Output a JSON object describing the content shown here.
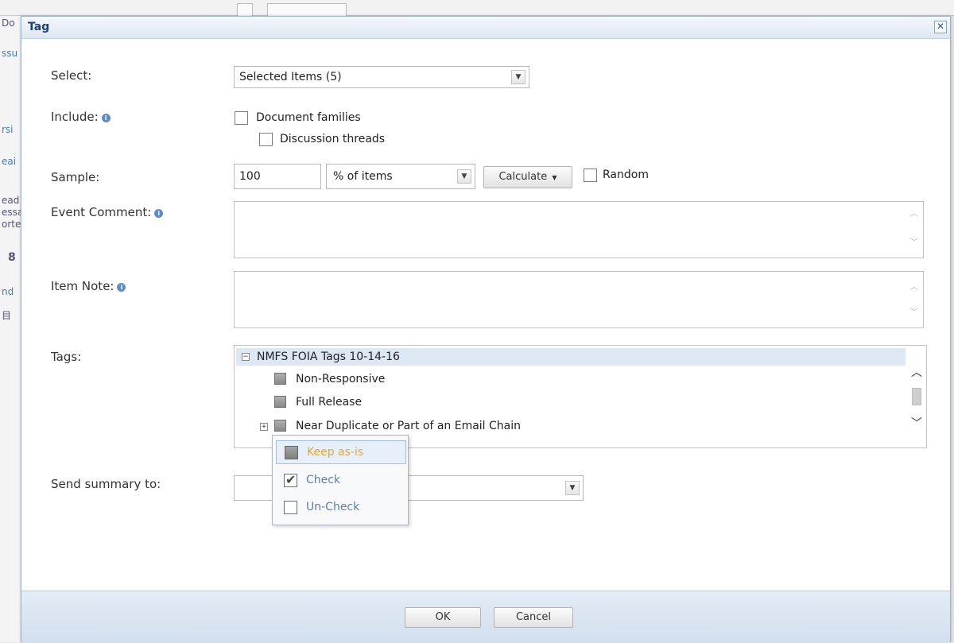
{
  "background": {
    "fragments": [
      "Do",
      "ssu",
      "rsi",
      "eai",
      "ead",
      "essa",
      "orte",
      "8",
      "nd",
      "目"
    ]
  },
  "dialog": {
    "title": "Tag",
    "close_glyph": "✕"
  },
  "form": {
    "select": {
      "label": "Select:",
      "value": "Selected Items (5)"
    },
    "include": {
      "label": "Include:",
      "document_families": "Document families",
      "discussion_threads": "Discussion threads"
    },
    "sample": {
      "label": "Sample:",
      "value": "100",
      "unit": "% of items",
      "calculate": "Calculate",
      "random": "Random"
    },
    "event_comment": {
      "label": "Event Comment:"
    },
    "item_note": {
      "label": "Item Note:"
    },
    "tags": {
      "label": "Tags:",
      "root": "NMFS FOIA Tags 10-14-16",
      "items": [
        "Non-Responsive",
        "Full Release",
        "Near Duplicate or Part of an Email Chain"
      ]
    },
    "send_summary": {
      "label": "Send summary to:",
      "value": ""
    }
  },
  "popup": {
    "options": [
      {
        "label": "Keep as-is",
        "state": "mixed"
      },
      {
        "label": "Check",
        "state": "checked"
      },
      {
        "label": "Un-Check",
        "state": "unchecked"
      }
    ]
  },
  "footer": {
    "ok": "OK",
    "cancel": "Cancel"
  },
  "icons": {
    "info": "i",
    "dropdown": "▼",
    "expand": "+",
    "collapse": "−",
    "scroll_up": "︿",
    "scroll_down": "﹀",
    "check": "✔"
  },
  "colors": {
    "title": "#1e3f73",
    "footer": "#d2dfed",
    "popup_hover_text": "#e0a83a",
    "link_text": "#5d7fa8"
  }
}
